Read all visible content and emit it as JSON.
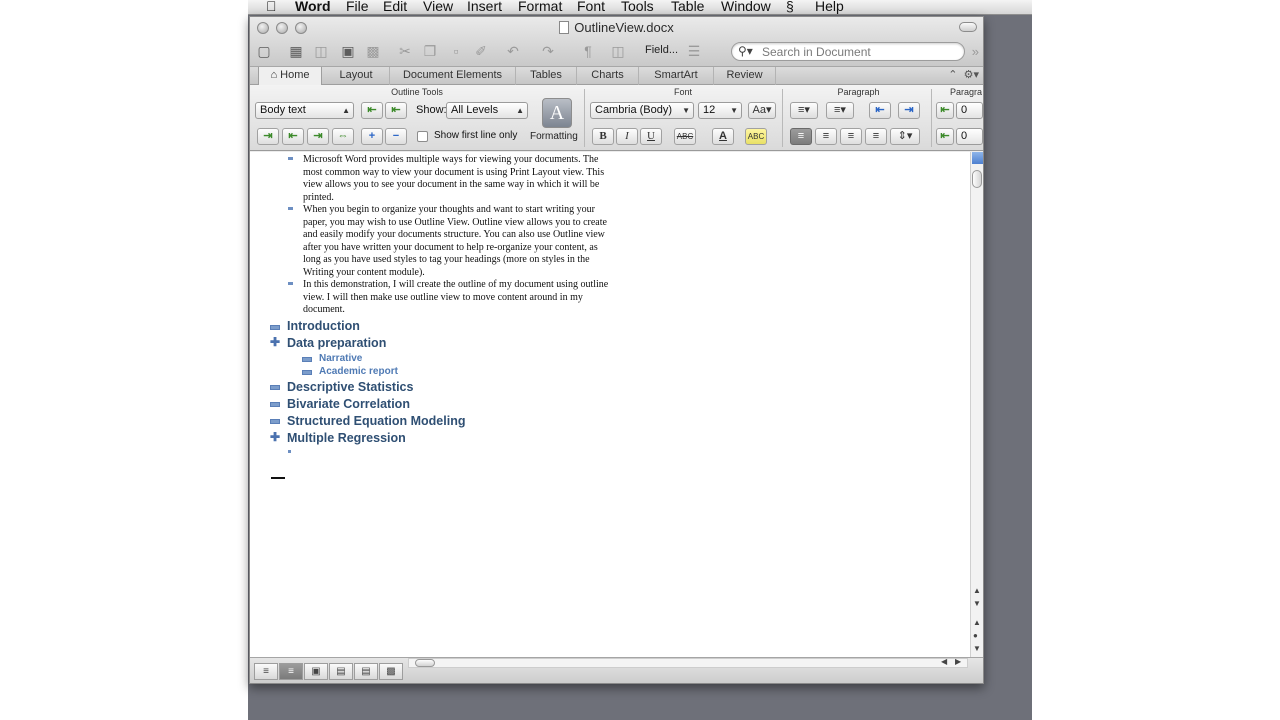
{
  "menubar": {
    "apple": "",
    "app": "Word",
    "items": [
      "File",
      "Edit",
      "View",
      "Insert",
      "Format",
      "Font",
      "Tools",
      "Table",
      "Window"
    ],
    "script_icon": "§",
    "help": "Help"
  },
  "window": {
    "title": "OutlineView.docx",
    "field_label": "Field...",
    "search_placeholder": "Search in Document"
  },
  "ribbon_tabs": [
    "Home",
    "Layout",
    "Document Elements",
    "Tables",
    "Charts",
    "SmartArt",
    "Review"
  ],
  "ribbon": {
    "outline_tools_title": "Outline Tools",
    "level_value": "Body text",
    "show_label": "Show:",
    "show_value": "All Levels",
    "first_line_label": "Show first line only",
    "formatting_label": "Formatting",
    "font_title": "Font",
    "font_name": "Cambria (Body)",
    "font_size": "12",
    "paragraph_title": "Paragraph",
    "paragraph2_title": "Paragra",
    "indent_value1": "0",
    "indent_value2": "0"
  },
  "document": {
    "body_paragraphs": [
      {
        "lines": [
          "Microsoft Word provides multiple ways for viewing your documents. The",
          "most common way to view your document is using Print Layout view. This",
          "view allows you to see your document in the same way in which it will be",
          "printed."
        ]
      },
      {
        "lines": [
          "When you begin to organize your thoughts and want to start writing your",
          "paper, you may wish to use Outline View. Outline view allows you to create",
          "and easily modify your documents structure. You can also use Outline view",
          "after you have written your document to help re-organize your content, as",
          "long as you have used styles to tag your headings (more on styles in the",
          "Writing your content module)."
        ]
      },
      {
        "lines": [
          "In this demonstration, I will create the outline of my document using outline",
          "view. I will then make use outline view to move content around in my",
          "document."
        ]
      }
    ],
    "headings": [
      {
        "text": "Introduction",
        "symbol": "minus"
      },
      {
        "text": "Data preparation",
        "symbol": "plus"
      },
      {
        "text": "Descriptive Statistics",
        "symbol": "minus"
      },
      {
        "text": "Bivariate Correlation",
        "symbol": "minus"
      },
      {
        "text": "Structured Equation Modeling",
        "symbol": "minus"
      },
      {
        "text": "Multiple Regression",
        "symbol": "plus"
      }
    ],
    "subheadings": [
      "Narrative",
      "Academic report"
    ]
  }
}
